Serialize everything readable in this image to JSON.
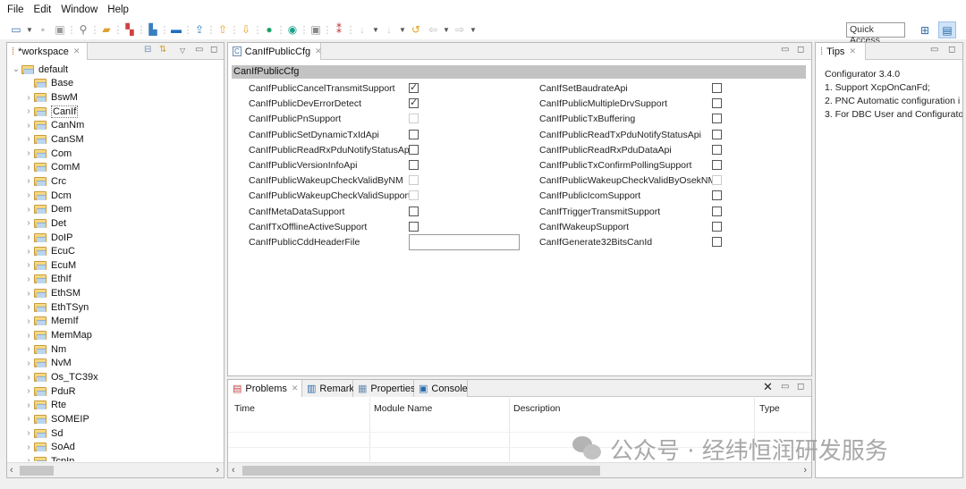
{
  "menu": [
    "File",
    "Edit",
    "Window",
    "Help"
  ],
  "toolbar": {
    "icons": [
      "new-wizard-icon",
      "dropdown-icon",
      "save-icon",
      "save-all-icon",
      "search-icon",
      "open-folder-icon",
      "modules-icon",
      "import-icon",
      "export-icon",
      "upload-icon",
      "move-up-icon",
      "move-down-icon",
      "validate-icon",
      "refresh-icon",
      "console-icon",
      "tree-config-icon",
      "disabled-icon",
      "dropdown-icon",
      "disabled-icon",
      "dropdown-icon",
      "back-icon",
      "prev-icon",
      "dropdown-icon",
      "forward-icon",
      "dropdown-icon"
    ],
    "quick_access": "Quick Access"
  },
  "workspace": {
    "tab_label": "*workspace",
    "root": "default",
    "items": [
      "Base",
      "BswM",
      "CanIf",
      "CanNm",
      "CanSM",
      "Com",
      "ComM",
      "Crc",
      "Dcm",
      "Dem",
      "Det",
      "DoIP",
      "EcuC",
      "EcuM",
      "EthIf",
      "EthSM",
      "EthTSyn",
      "MemIf",
      "MemMap",
      "Nm",
      "NvM",
      "Os_TC39x",
      "PduR",
      "Rte",
      "SOMEIP",
      "Sd",
      "SoAd",
      "TcpIp"
    ],
    "selected": "CanIf"
  },
  "editor": {
    "tab_label": "CanIfPublicCfg",
    "section_title": "CanIfPublicCfg",
    "left_fields": [
      {
        "label": "CanIfPublicCancelTransmitSupport",
        "type": "checkbox",
        "checked": true,
        "enabled": true
      },
      {
        "label": "CanIfPublicDevErrorDetect",
        "type": "checkbox",
        "checked": true,
        "enabled": true
      },
      {
        "label": "CanIfPublicPnSupport",
        "type": "checkbox",
        "checked": false,
        "enabled": false
      },
      {
        "label": "CanIfPublicSetDynamicTxIdApi",
        "type": "checkbox",
        "checked": false,
        "enabled": true
      },
      {
        "label": "CanIfPublicReadRxPduNotifyStatusApi",
        "type": "checkbox",
        "checked": false,
        "enabled": true
      },
      {
        "label": "CanIfPublicVersionInfoApi",
        "type": "checkbox",
        "checked": false,
        "enabled": true
      },
      {
        "label": "CanIfPublicWakeupCheckValidByNM",
        "type": "checkbox",
        "checked": false,
        "enabled": false
      },
      {
        "label": "CanIfPublicWakeupCheckValidSupport",
        "type": "checkbox",
        "checked": false,
        "enabled": false
      },
      {
        "label": "CanIfMetaDataSupport",
        "type": "checkbox",
        "checked": false,
        "enabled": true
      },
      {
        "label": "CanIfTxOfflineActiveSupport",
        "type": "checkbox",
        "checked": false,
        "enabled": true
      },
      {
        "label": "CanIfPublicCddHeaderFile",
        "type": "text",
        "value": ""
      }
    ],
    "right_fields": [
      {
        "label": "CanIfSetBaudrateApi",
        "checked": false,
        "enabled": true
      },
      {
        "label": "CanIfPublicMultipleDrvSupport",
        "checked": false,
        "enabled": true
      },
      {
        "label": "CanIfPublicTxBuffering",
        "checked": false,
        "enabled": true
      },
      {
        "label": "CanIfPublicReadTxPduNotifyStatusApi",
        "checked": false,
        "enabled": true
      },
      {
        "label": "CanIfPublicReadRxPduDataApi",
        "checked": false,
        "enabled": true
      },
      {
        "label": "CanIfPublicTxConfirmPollingSupport",
        "checked": false,
        "enabled": true
      },
      {
        "label": "CanIfPublicWakeupCheckValidByOsekNM",
        "checked": false,
        "enabled": false
      },
      {
        "label": "CanIfPublicIcomSupport",
        "checked": false,
        "enabled": true
      },
      {
        "label": "CanIfTriggerTransmitSupport",
        "checked": false,
        "enabled": true
      },
      {
        "label": "CanIfWakeupSupport",
        "checked": false,
        "enabled": true
      },
      {
        "label": "CanIfGenerate32BitsCanId",
        "checked": false,
        "enabled": true
      }
    ]
  },
  "tips": {
    "tab_label": "Tips",
    "lines": [
      "Configurator 3.4.0",
      "1. Support XcpOnCanFd;",
      "2. PNC Automatic configuration i",
      "3. For DBC User and Configurato"
    ]
  },
  "bottom": {
    "tabs": [
      "Problems",
      "Remark",
      "Properties",
      "Console"
    ],
    "active_tab": "Problems",
    "columns": [
      "Time",
      "Module Name",
      "Description",
      "Type"
    ],
    "rows": []
  },
  "watermark": "公众号 · 经纬恒润研发服务"
}
